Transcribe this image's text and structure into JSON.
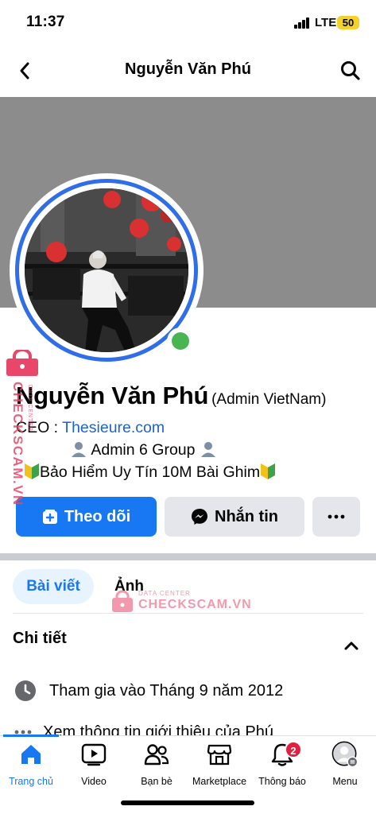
{
  "status_bar": {
    "time": "11:37",
    "network": "LTE",
    "battery": "50"
  },
  "header": {
    "title": "Nguyễn Văn Phú"
  },
  "profile": {
    "name": "Nguyễn Văn Phú",
    "alternate_name": "(Admin VietNam)",
    "bio_ceo_prefix": "CEO : ",
    "bio_ceo_link": "Thesieure.com",
    "bio_line2": " Admin 6 Group ",
    "bio_line3": "Bảo Hiểm Uy Tín 10M Bài Ghim"
  },
  "actions": {
    "follow": "Theo dõi",
    "message": "Nhắn tin"
  },
  "tabs": {
    "posts": "Bài viết",
    "photos": "Ảnh"
  },
  "details": {
    "title": "Chi tiết",
    "joined": "Tham gia vào Tháng 9 năm 2012",
    "about": "Xem thông tin giới thiệu của Phú"
  },
  "bottom_nav": {
    "items": [
      {
        "label": "Trang chủ",
        "icon": "home-icon"
      },
      {
        "label": "Video",
        "icon": "video-icon"
      },
      {
        "label": "Bạn bè",
        "icon": "friends-icon"
      },
      {
        "label": "Marketplace",
        "icon": "marketplace-icon"
      },
      {
        "label": "Thông báo",
        "icon": "bell-icon"
      },
      {
        "label": "Menu",
        "icon": "menu-avatar-icon"
      }
    ],
    "notification_count": "2"
  },
  "watermark": {
    "small": "DATA CENTER",
    "big": "CHECKSCAM.VN"
  },
  "colors": {
    "accent": "#1877f2",
    "online": "#48b553",
    "badge": "#e41e3f",
    "watermark": "#e8476a"
  }
}
